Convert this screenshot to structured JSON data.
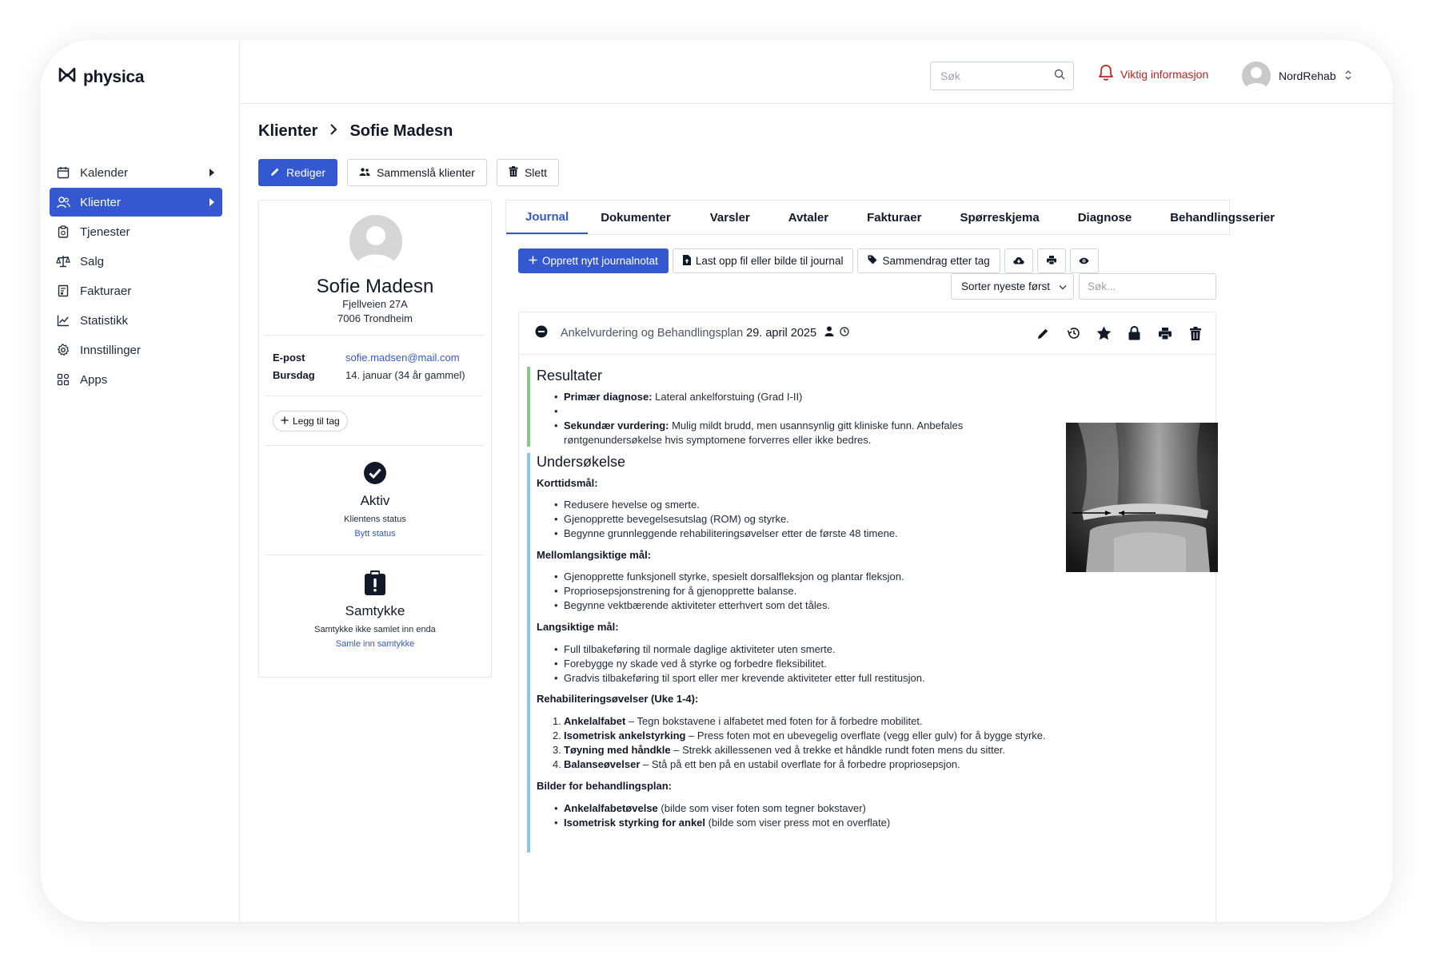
{
  "app": {
    "name": "physica"
  },
  "sidebar": {
    "items": [
      {
        "label": "Kalender",
        "icon": "calendar-icon",
        "active": false,
        "arrow": true
      },
      {
        "label": "Klienter",
        "icon": "users-icon",
        "active": true,
        "arrow": true
      },
      {
        "label": "Tjenester",
        "icon": "clipboard-icon",
        "active": false
      },
      {
        "label": "Salg",
        "icon": "scale-icon",
        "active": false
      },
      {
        "label": "Fakturaer",
        "icon": "invoice-icon",
        "active": false
      },
      {
        "label": "Statistikk",
        "icon": "chart-line-icon",
        "active": false
      },
      {
        "label": "Innstillinger",
        "icon": "gear-icon",
        "active": false
      },
      {
        "label": "Apps",
        "icon": "apps-grid-icon",
        "active": false
      }
    ]
  },
  "header": {
    "search_placeholder": "Søk",
    "notice_label": "Viktig informasjon",
    "user_name": "NordRehab"
  },
  "breadcrumb": {
    "parent": "Klienter",
    "current": "Sofie Madesn"
  },
  "actions": {
    "edit": "Rediger",
    "merge": "Sammenslå klienter",
    "delete": "Slett"
  },
  "client": {
    "name": "Sofie Madesn",
    "street": "Fjellveien 27A",
    "city": "7006 Trondheim",
    "email_label": "E-post",
    "email": "sofie.madsen@mail.com",
    "birthday_label": "Bursdag",
    "birthday": "14. januar (34 år gammel)",
    "add_tag": "Legg til tag",
    "status_title": "Aktiv",
    "status_sub": "Klientens status",
    "status_link": "Bytt status",
    "consent_title": "Samtykke",
    "consent_sub": "Samtykke ikke samlet inn enda",
    "consent_link": "Samle inn samtykke"
  },
  "tabs": [
    "Journal",
    "Dokumenter",
    "Varsler",
    "Avtaler",
    "Fakturaer",
    "Spørreskjema",
    "Diagnose",
    "Behandlingsserier"
  ],
  "active_tab": "Journal",
  "toolbar": {
    "new_note": "Opprett nytt journalnotat",
    "upload": "Last opp fil eller bilde til journal",
    "summary": "Sammendrag etter tag",
    "sort": "Sorter nyeste først",
    "search_placeholder": "Søk..."
  },
  "note": {
    "title": "Ankelvurdering og Behandlingsplan",
    "date": "29. april 2025",
    "results_heading": "Resultater",
    "results": [
      {
        "bold": "Primær diagnose:",
        "text": " Lateral ankelforstuing (Grad I-II)"
      },
      {
        "bold": "",
        "text": ""
      },
      {
        "bold": "Sekundær vurdering:",
        "text": " Mulig mildt brudd, men usannsynlig gitt kliniske funn. Anbefales røntgenundersøkelse hvis symptomene forverres eller ikke bedres."
      }
    ],
    "exam_heading": "Undersøkelse",
    "short_heading": "Korttidsmål:",
    "short": [
      "Redusere hevelse og smerte.",
      "Gjenopprette bevegelsesutslag (ROM) og styrke.",
      "Begynne grunnleggende rehabiliteringsøvelser etter de første 48 timene."
    ],
    "mid_heading": "Mellomlangsiktige mål:",
    "mid": [
      "Gjenopprette funksjonell styrke, spesielt dorsalfleksjon og plantar fleksjon.",
      "Propriosepsjonstrening for å gjenopprette balanse.",
      "Begynne vektbærende aktiviteter etterhvert som det tåles."
    ],
    "long_heading": "Langsiktige mål:",
    "long": [
      "Full tilbakeføring til normale daglige aktiviteter uten smerte.",
      "Forebygge ny skade ved å styrke og forbedre fleksibilitet.",
      "Gradvis tilbakeføring til sport eller mer krevende aktiviteter etter full restitusjon."
    ],
    "rehab_heading": "Rehabiliteringsøvelser (Uke 1-4):",
    "rehab": [
      {
        "n": "1.",
        "bold": "Ankelalfabet",
        "text": " – Tegn bokstavene i alfabetet med foten for å forbedre mobilitet."
      },
      {
        "n": "2.",
        "bold": "Isometrisk ankelstyrking",
        "text": " – Press foten mot en ubevegelig overflate (vegg eller gulv) for å bygge styrke."
      },
      {
        "n": "3.",
        "bold": "Tøyning med håndkle",
        "text": " – Strekk akillessenen ved å trekke et håndkle rundt foten mens du sitter."
      },
      {
        "n": "4.",
        "bold": "Balanseøvelser",
        "text": " – Stå på ett ben på en ustabil overflate for å forbedre propriosepsjon."
      }
    ],
    "images_heading": "Bilder for behandlingsplan:",
    "images": [
      {
        "bold": "Ankelalfabetøvelse",
        "text": " (bilde som viser foten som tegner bokstaver)"
      },
      {
        "bold": "Isometrisk styrking for ankel",
        "text": " (bilde som viser press mot en overflate)"
      }
    ]
  },
  "colors": {
    "primary": "#3458d0",
    "alert": "#c81e1e",
    "results_bar": "#86c88b",
    "exam_bar": "#8fc3e8"
  }
}
